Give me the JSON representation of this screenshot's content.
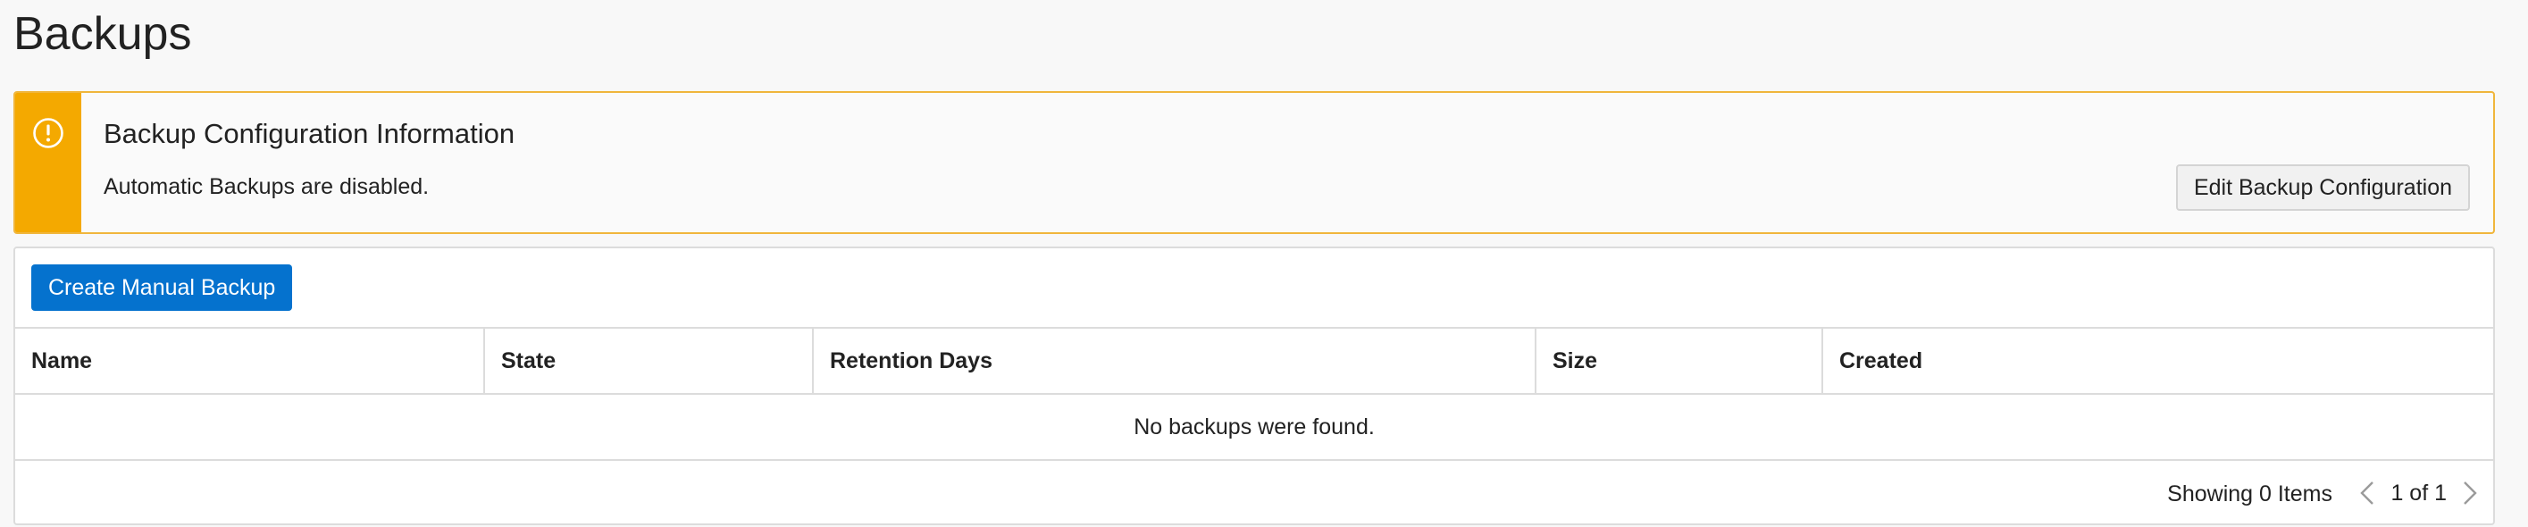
{
  "page": {
    "title": "Backups"
  },
  "notice": {
    "title": "Backup Configuration Information",
    "message": "Automatic Backups are disabled.",
    "edit_button": "Edit Backup Configuration",
    "stripe_color": "#f4a900",
    "border_color": "#f0b63c",
    "icon": "warning-circle-icon"
  },
  "toolbar": {
    "create_button": "Create Manual Backup",
    "button_color": "#0572ce"
  },
  "table": {
    "columns": [
      "Name",
      "State",
      "Retention Days",
      "Size",
      "Created"
    ],
    "rows": [],
    "empty_message": "No backups were found."
  },
  "pagination": {
    "showing": "Showing 0 Items",
    "page_info": "1 of 1",
    "prev_icon": "chevron-left-icon",
    "next_icon": "chevron-right-icon"
  }
}
